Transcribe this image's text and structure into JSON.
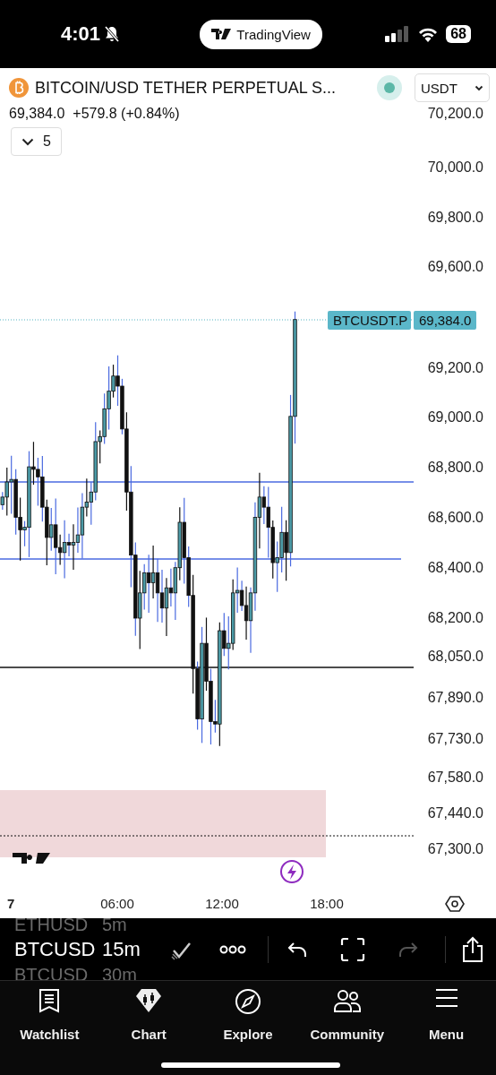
{
  "status_bar": {
    "time": "4:01",
    "app_pill": "TradingView",
    "battery": "68"
  },
  "symbol": {
    "title": "BITCOIN/USD TETHER PERPETUAL S...",
    "market_open": true,
    "currency": "USDT",
    "price": "69,384.0",
    "change": "+579.8 (+0.84%)",
    "indicators_count": "5"
  },
  "chart": {
    "price_axis": [
      "70,200.0",
      "70,000.0",
      "69,800.0",
      "69,600.0",
      "69,200.0",
      "69,000.0",
      "68,800.0",
      "68,600.0",
      "68,400.0",
      "68,200.0",
      "68,050.0",
      "67,890.0",
      "67,730.0",
      "67,580.0",
      "67,440.0",
      "67,300.0"
    ],
    "last_price_tag": {
      "symbol": "BTCUSDT.P",
      "price": "69,384.0"
    },
    "time_axis": [
      "7",
      "06:00",
      "12:00",
      "18:00"
    ]
  },
  "toolbar": {
    "symbol_picker": [
      {
        "symbol": "ETHUSD",
        "interval": "5m",
        "selected": false
      },
      {
        "symbol": "BTCUSD",
        "interval": "15m",
        "selected": true
      },
      {
        "symbol": "BTCUSD",
        "interval": "30m",
        "selected": false
      }
    ],
    "redo_disabled": true
  },
  "tab_bar": [
    {
      "label": "Watchlist",
      "kind": "watchlist"
    },
    {
      "label": "Chart",
      "kind": "chart"
    },
    {
      "label": "Explore",
      "kind": "explore"
    },
    {
      "label": "Community",
      "kind": "community"
    },
    {
      "label": "Menu",
      "kind": "menu"
    }
  ]
}
